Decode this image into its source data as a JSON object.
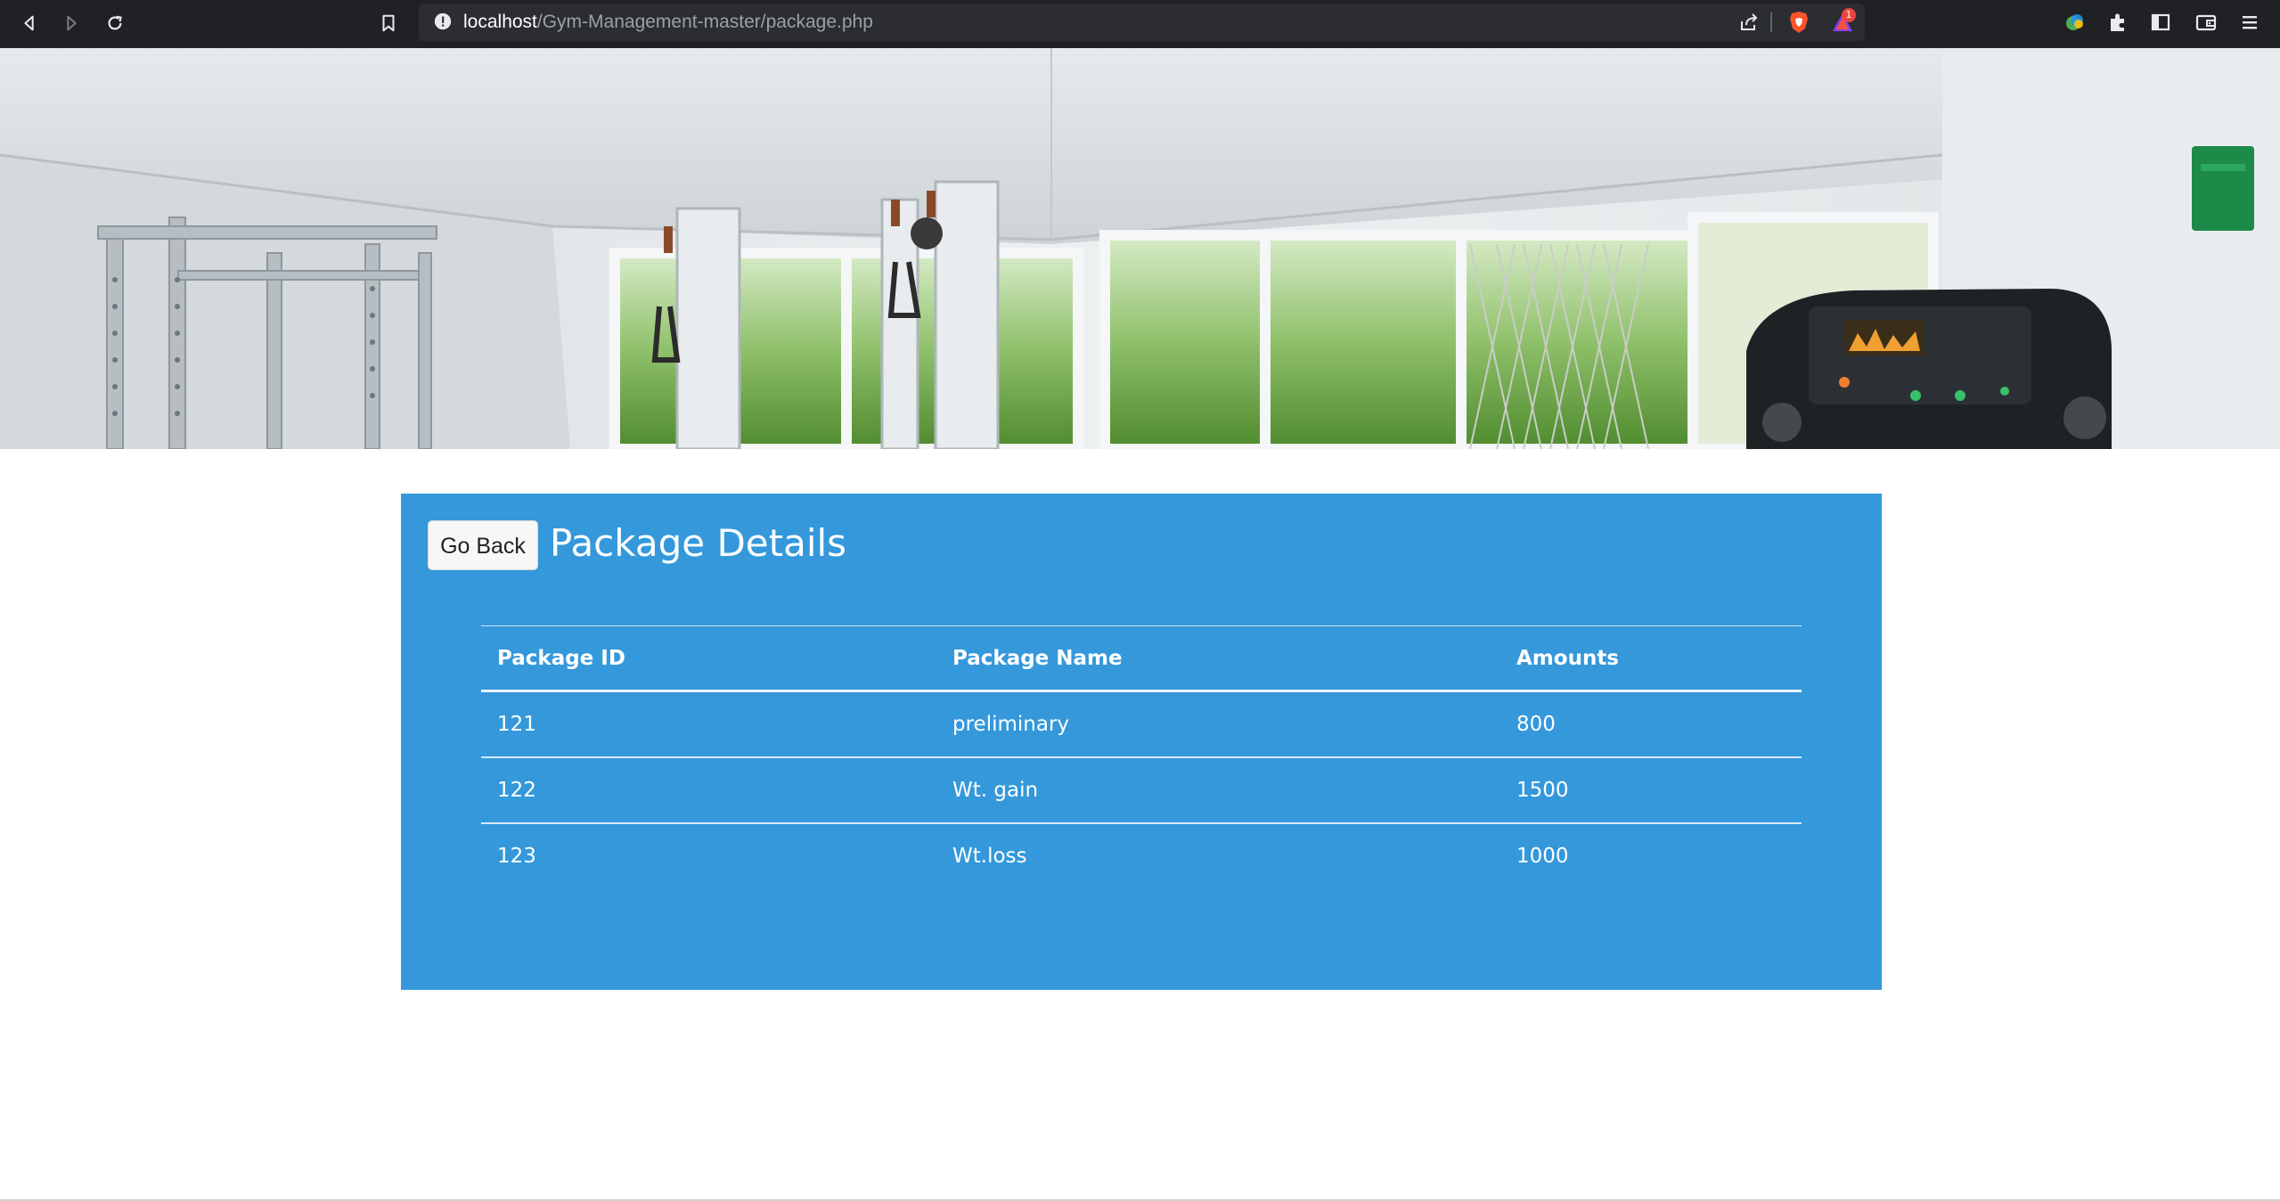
{
  "browser": {
    "url_host": "localhost",
    "url_path": "/Gym-Management-master/package.php",
    "rewards_badge": "1"
  },
  "page": {
    "go_back_label": "Go Back",
    "title": "Package Details",
    "table": {
      "headers": [
        "Package ID",
        "Package Name",
        "Amounts"
      ],
      "rows": [
        [
          "121",
          "preliminary",
          "800"
        ],
        [
          "122",
          "Wt. gain",
          "1500"
        ],
        [
          "123",
          "Wt.loss",
          "1000"
        ]
      ]
    }
  },
  "colors": {
    "panel": "#3498db",
    "chrome": "#202124",
    "urlbar": "#2b2d31"
  }
}
